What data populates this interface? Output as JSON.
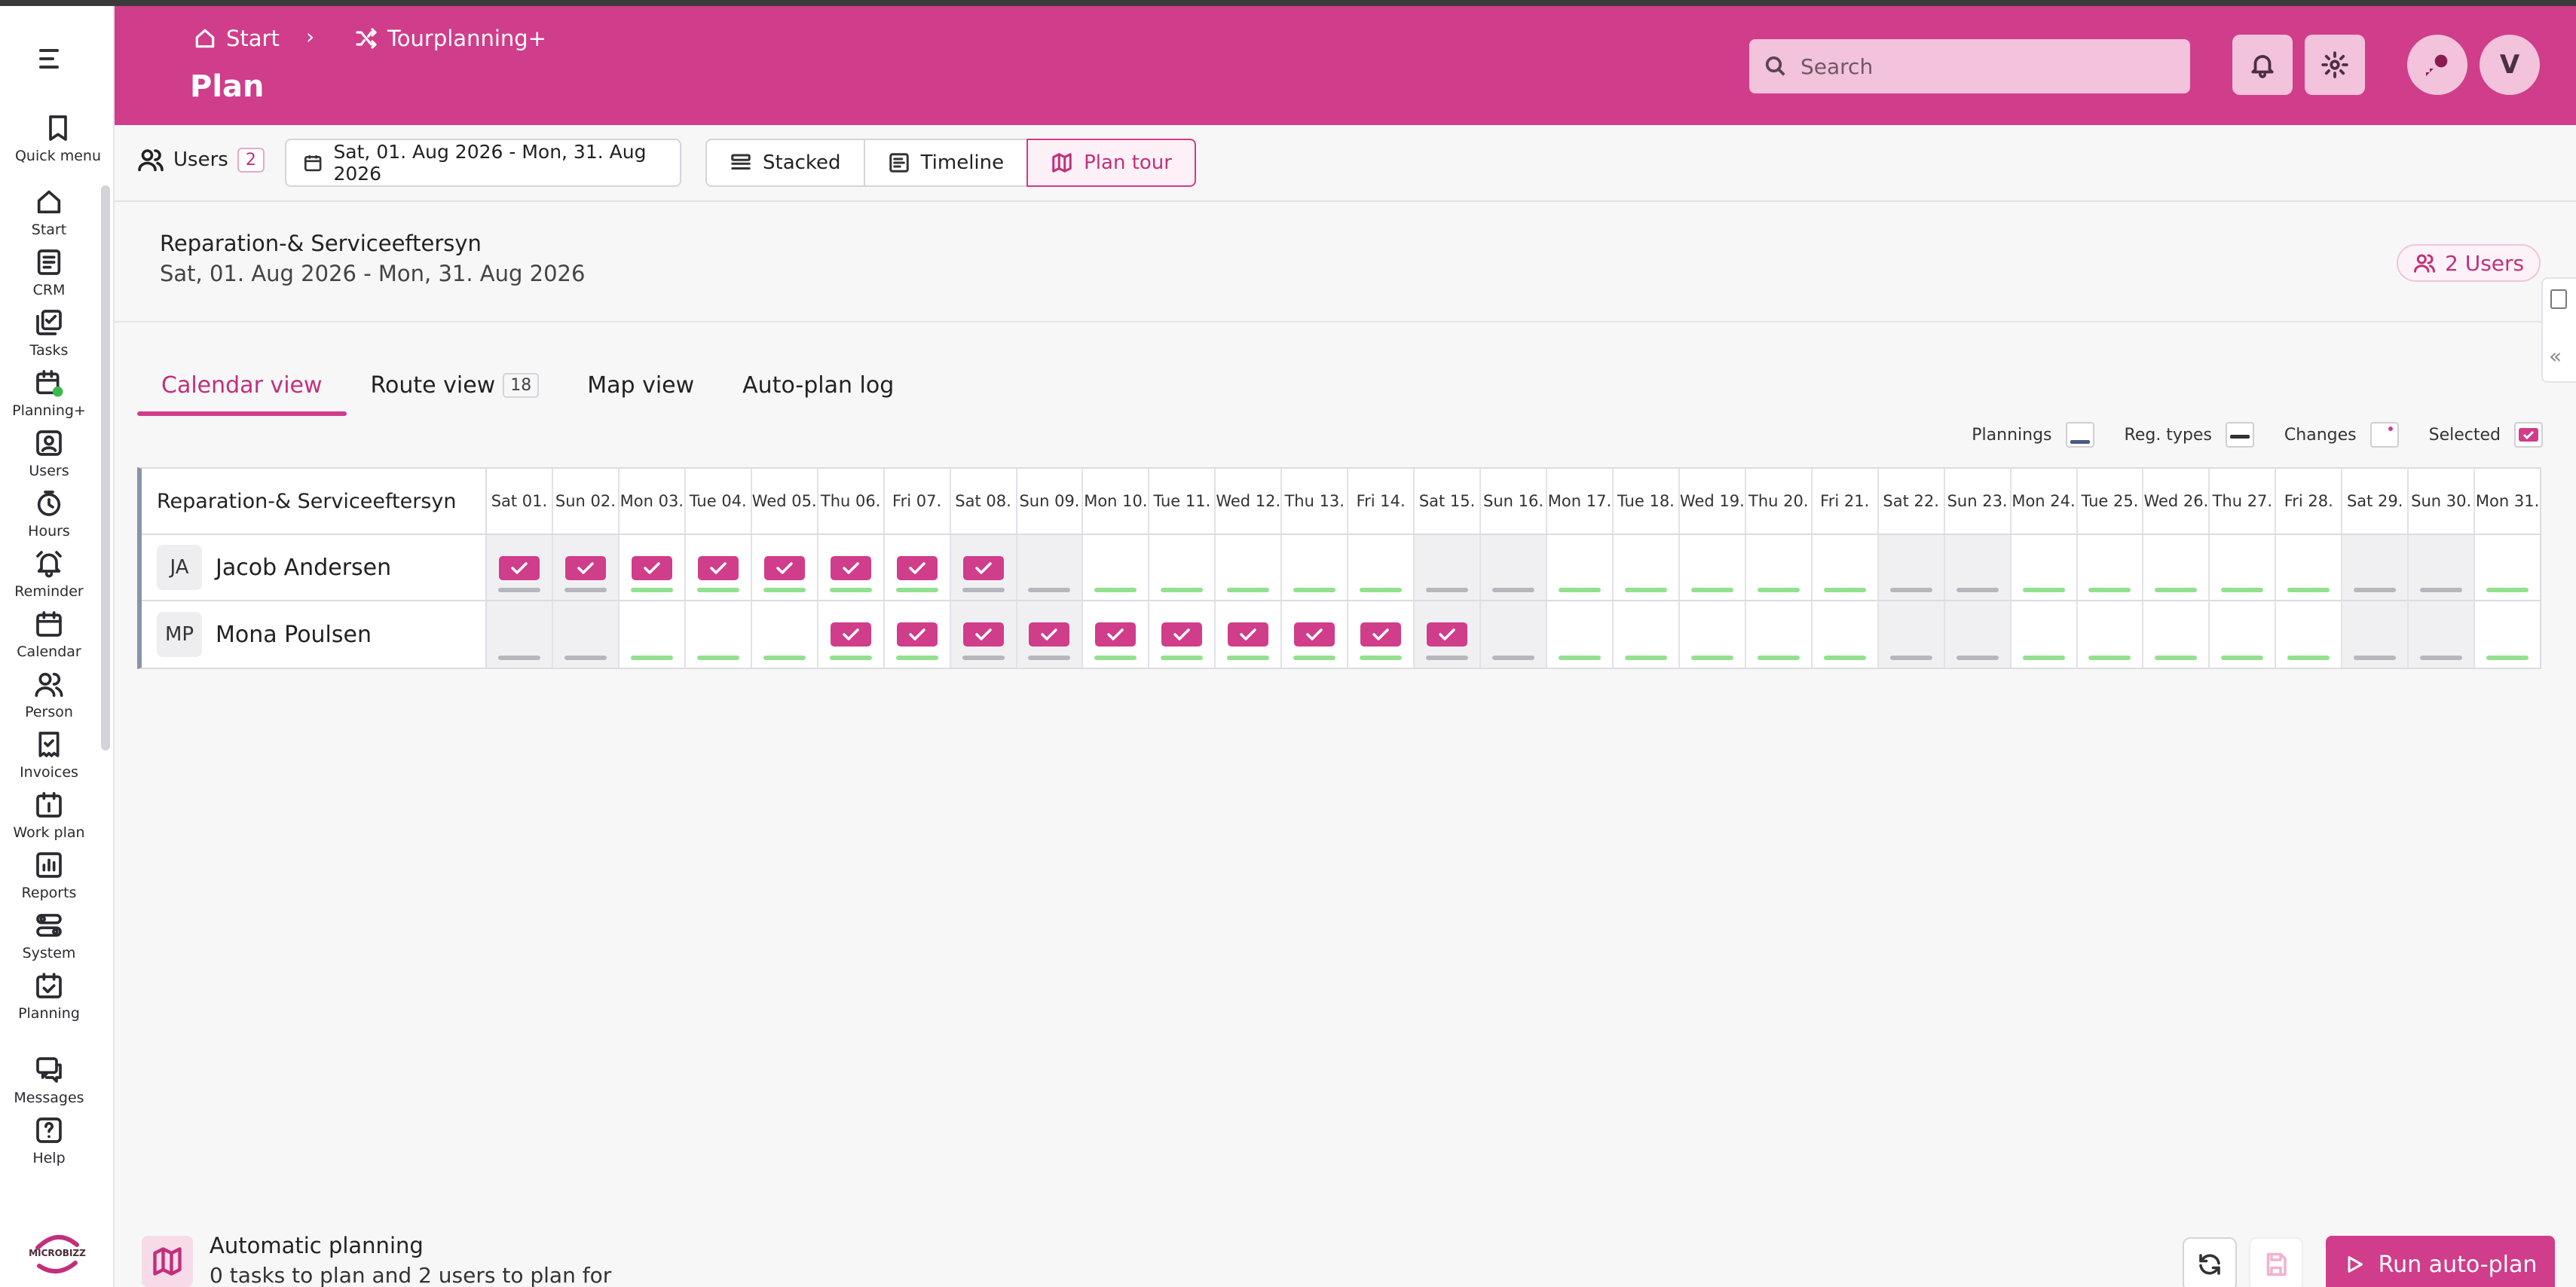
{
  "sidebar": {
    "items": [
      {
        "label": "Quick menu",
        "icon": "bookmark-icon"
      },
      {
        "label": "Start",
        "icon": "home-icon"
      },
      {
        "label": "CRM",
        "icon": "crm-icon"
      },
      {
        "label": "Tasks",
        "icon": "tasks-icon"
      },
      {
        "label": "Planning+",
        "icon": "planning-plus-icon"
      },
      {
        "label": "Users",
        "icon": "users-icon"
      },
      {
        "label": "Hours",
        "icon": "clock-icon"
      },
      {
        "label": "Reminder",
        "icon": "bell-icon"
      },
      {
        "label": "Calendar",
        "icon": "calendar-icon"
      },
      {
        "label": "Person",
        "icon": "person-icon"
      },
      {
        "label": "Invoices",
        "icon": "invoice-icon"
      },
      {
        "label": "Work plan",
        "icon": "work-plan-icon"
      },
      {
        "label": "Reports",
        "icon": "reports-icon"
      },
      {
        "label": "System",
        "icon": "system-icon"
      },
      {
        "label": "Planning",
        "icon": "planning-icon"
      },
      {
        "label": "Messages",
        "icon": "messages-icon"
      },
      {
        "label": "Help",
        "icon": "help-icon"
      }
    ],
    "logo_text": "MICROBIZZ"
  },
  "header": {
    "breadcrumb": [
      {
        "label": "Start",
        "icon": "home-icon"
      },
      {
        "label": "Tourplanning+",
        "icon": "shuffle-icon"
      }
    ],
    "title": "Plan",
    "search_placeholder": "Search",
    "avatar_initial": "V"
  },
  "toolbar": {
    "users_label": "Users",
    "users_count": "2",
    "date_range": "Sat, 01. Aug 2026 - Mon, 31. Aug 2026",
    "views": [
      {
        "label": "Stacked",
        "active": false
      },
      {
        "label": "Timeline",
        "active": false
      },
      {
        "label": "Plan tour",
        "active": true
      }
    ]
  },
  "info": {
    "title": "Reparation-& Serviceeftersyn",
    "subtitle": "Sat, 01. Aug 2026 - Mon, 31. Aug 2026",
    "users_pill": "2 Users"
  },
  "tabs": [
    {
      "label": "Calendar view",
      "active": true
    },
    {
      "label": "Route view",
      "count": "18"
    },
    {
      "label": "Map view"
    },
    {
      "label": "Auto-plan log"
    }
  ],
  "legend": {
    "plannings": "Plannings",
    "reg_types": "Reg. types",
    "changes": "Changes",
    "selected": "Selected"
  },
  "grid": {
    "header_label": "Reparation-& Serviceeftersyn",
    "days": [
      "Sat 01.",
      "Sun 02.",
      "Mon 03.",
      "Tue 04.",
      "Wed 05.",
      "Thu 06.",
      "Fri 07.",
      "Sat 08.",
      "Sun 09.",
      "Mon 10.",
      "Tue 11.",
      "Wed 12.",
      "Thu 13.",
      "Fri 14.",
      "Sat 15.",
      "Sun 16.",
      "Mon 17.",
      "Tue 18.",
      "Wed 19.",
      "Thu 20.",
      "Fri 21.",
      "Sat 22.",
      "Sun 23.",
      "Mon 24.",
      "Tue 25.",
      "Wed 26.",
      "Thu 27.",
      "Fri 28.",
      "Sat 29.",
      "Sun 30.",
      "Mon 31."
    ],
    "weekend_days": [
      0,
      1,
      7,
      8,
      14,
      15,
      21,
      22,
      28,
      29
    ],
    "users": [
      {
        "initials": "JA",
        "name": "Jacob Andersen",
        "selected_days": [
          0,
          1,
          2,
          3,
          4,
          5,
          6,
          7
        ]
      },
      {
        "initials": "MP",
        "name": "Mona Poulsen",
        "selected_days": [
          5,
          6,
          7,
          8,
          9,
          10,
          11,
          12,
          13,
          14
        ]
      }
    ]
  },
  "bottom": {
    "title": "Automatic planning",
    "subtitle": "0 tasks to plan and 2 users to plan for",
    "run_label": "Run auto-plan"
  },
  "colors": {
    "brand": "#d03d8a",
    "working_day_bar": "#93e08f",
    "off_day_bar": "#b6b6bd"
  }
}
